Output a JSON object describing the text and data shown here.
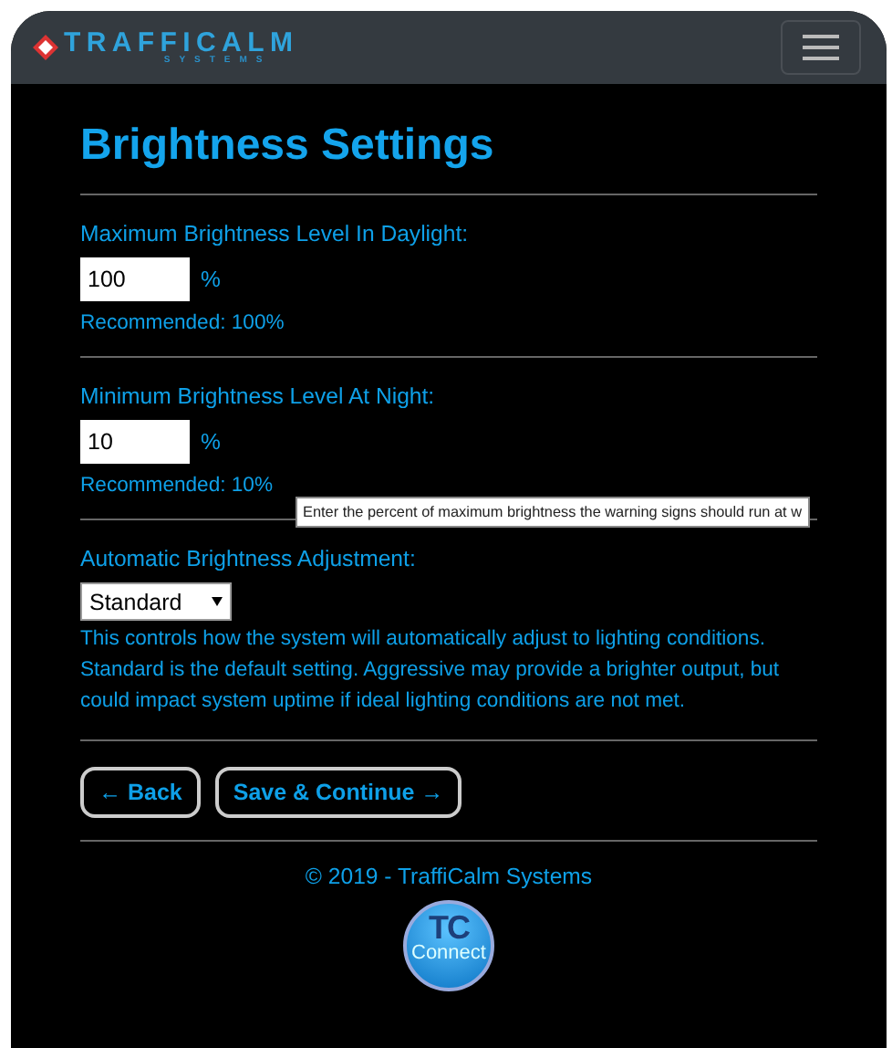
{
  "header": {
    "logo_text": "TRAFFICALM",
    "logo_subtext": "SYSTEMS"
  },
  "title": "Brightness Settings",
  "sections": [
    {
      "kind": "percent",
      "label": "Maximum Brightness Level In Daylight:",
      "value": "100",
      "unit": "%",
      "note": "Recommended: 100%"
    },
    {
      "kind": "percent",
      "label": "Minimum Brightness Level At Night:",
      "value": "10",
      "unit": "%",
      "note": "Recommended: 10%",
      "tooltip": "Enter the percent of maximum brightness the warning signs should run at w"
    },
    {
      "kind": "select",
      "label": "Automatic Brightness Adjustment:",
      "value": "Standard",
      "description": "This controls how the system will automatically adjust to lighting conditions. Standard is the default setting. Aggressive may provide a brighter output, but could impact system uptime if ideal lighting conditions are not met."
    }
  ],
  "buttons": [
    {
      "label": "← Back"
    },
    {
      "label": "Save & Continue →"
    }
  ],
  "footer": "© 2019 - TraffiCalm Systems",
  "badge": {
    "top": "TC",
    "bottom": "Connect"
  }
}
